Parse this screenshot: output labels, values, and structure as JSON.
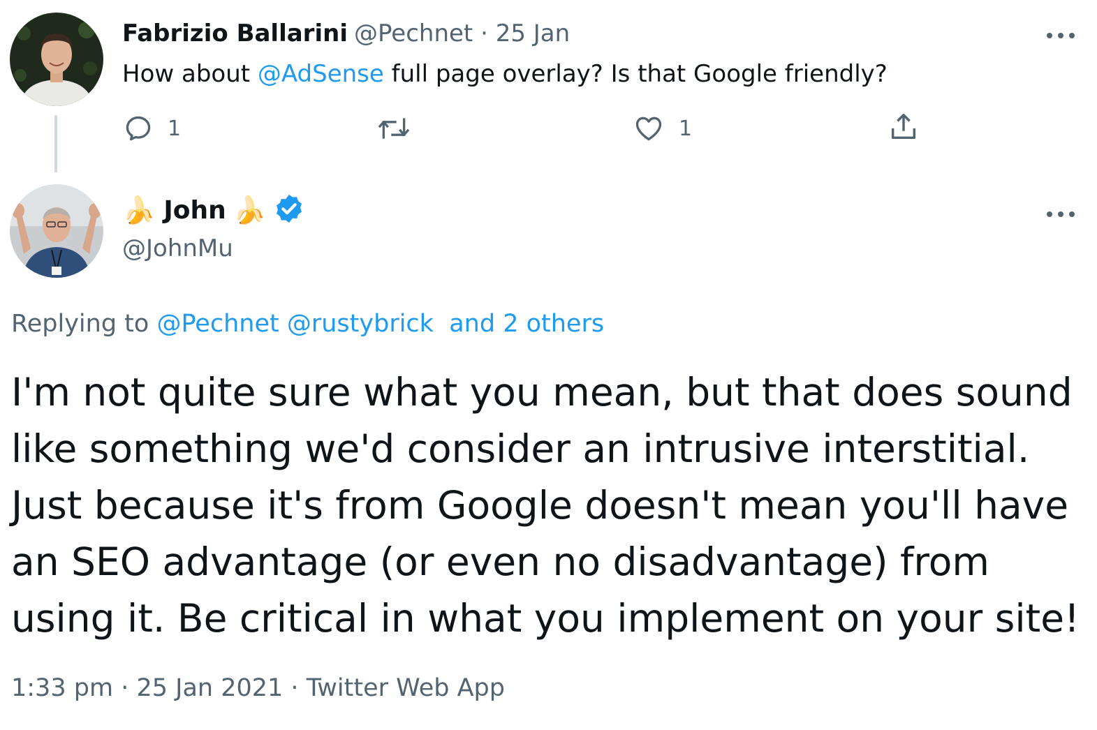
{
  "tweet1": {
    "author_name": "Fabrizio Ballarini",
    "handle": "@Pechnet",
    "separator": "·",
    "date": "25 Jan",
    "text_before": "How about ",
    "mention": "@AdSense",
    "text_after": " full page overlay? Is that Google friendly?",
    "reply_count": "1",
    "like_count": "1",
    "more_icon": "more-horizontal-icon"
  },
  "tweet2": {
    "author_name": "John",
    "name_emoji": "🍌",
    "handle": "@JohnMu",
    "verified_icon": "verified-badge-icon",
    "replying_prefix": "Replying to ",
    "replying_mention_1": "@Pechnet",
    "replying_mention_2": "@rustybrick",
    "replying_others": "and 2 others",
    "text": "I'm not quite sure what you mean, but that does sound like something we'd consider an intrusive interstitial. Just because it's from Google doesn't mean you'll have an SEO advantage (or even no disadvantage) from using it. Be critical in what you implement on your site!",
    "time": "1:33 pm",
    "separator": "·",
    "date": "25 Jan 2021",
    "source": "Twitter Web App"
  },
  "colors": {
    "link": "#1d9bf0",
    "muted": "#536471",
    "text": "#0f1419",
    "thread_line": "#cfd9de",
    "verified": "#1d9bf0"
  }
}
